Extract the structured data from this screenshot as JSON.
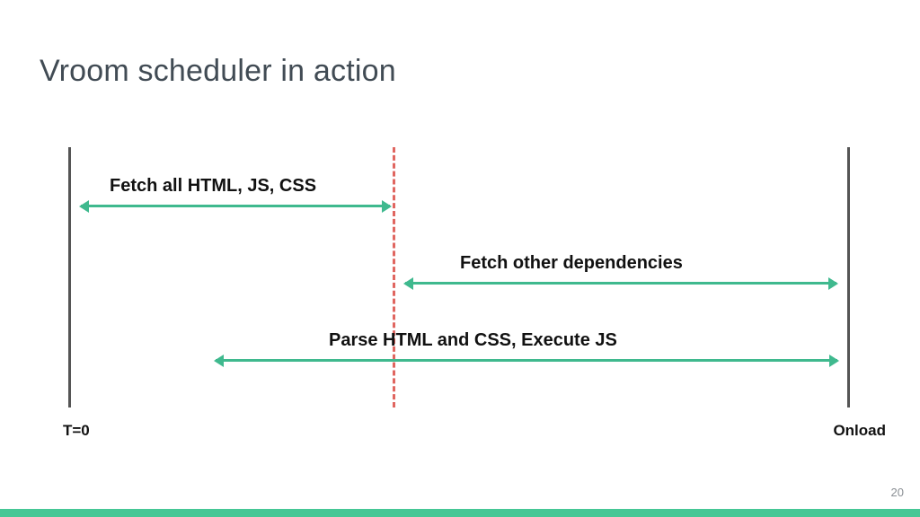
{
  "title": "Vroom scheduler in action",
  "axis": {
    "left": "T=0",
    "right": "Onload"
  },
  "spans": {
    "fetch_main": "Fetch all HTML, JS, CSS",
    "fetch_deps": "Fetch other dependencies",
    "parse_exec": "Parse HTML and CSS, Execute JS"
  },
  "page_number": "20",
  "colors": {
    "accent": "#46c795",
    "arrow": "#3fb98e",
    "marker": "#e06660"
  }
}
